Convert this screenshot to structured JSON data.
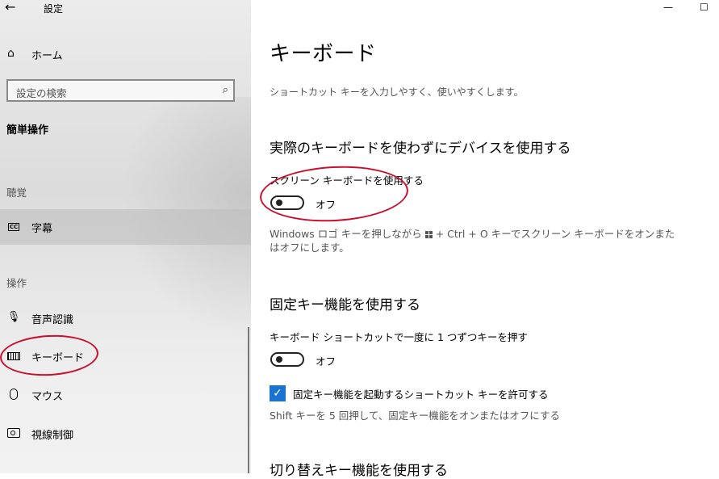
{
  "window": {
    "title": "設定",
    "back_icon": "←",
    "minimize_icon": "—",
    "maximize_icon": "☐"
  },
  "sidebar": {
    "home_label": "ホーム",
    "search_placeholder": "設定の検索",
    "category_title": "簡単操作",
    "groups": [
      {
        "label": "聴覚"
      },
      {
        "label": "操作"
      }
    ],
    "items": [
      {
        "label": "字幕",
        "icon": "cc-icon",
        "icon_text": "CC"
      },
      {
        "label": "音声認識",
        "icon": "microphone-icon",
        "icon_text": "🎙"
      },
      {
        "label": "キーボード",
        "icon": "keyboard-icon"
      },
      {
        "label": "マウス",
        "icon": "mouse-icon"
      },
      {
        "label": "視線制御",
        "icon": "eye-control-icon"
      }
    ]
  },
  "main": {
    "title": "キーボード",
    "description": "ショートカット キーを入力しやすく、使いやすくします。",
    "onscreen": {
      "section_title": "実際のキーボードを使わずにデバイスを使用する",
      "setting_label": "スクリーン キーボードを使用する",
      "state": "オフ",
      "help_part1": "Windows ロゴ キーを押しながら",
      "help_part2": "+ Ctrl + O キーでスクリーン キーボードをオンまた",
      "help_line2": "はオフにします。"
    },
    "sticky": {
      "section_title": "固定キー機能を使用する",
      "setting_label": "キーボード ショートカットで一度に 1 つずつキーを押す",
      "state": "オフ",
      "checkbox_label": "固定キー機能を起動するショートカット キーを許可する",
      "help": "Shift キーを 5 回押して、固定キー機能をオンまたはオフにする"
    },
    "toggle": {
      "section_title": "切り替えキー機能を使用する"
    }
  },
  "colors": {
    "accent": "#1873d3",
    "annotation": "#c8102e"
  }
}
